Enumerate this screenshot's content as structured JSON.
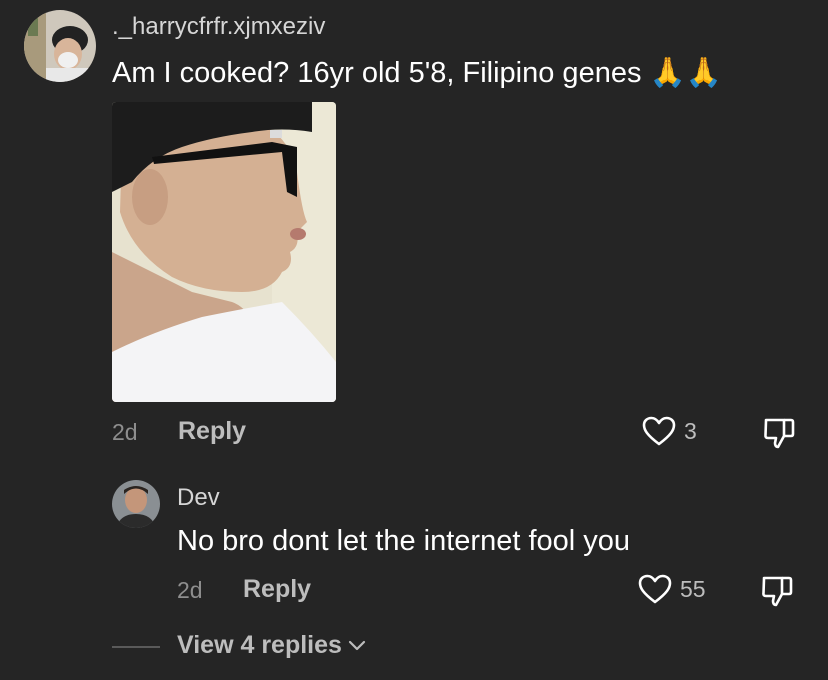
{
  "comment": {
    "username": "._harrycfrfr.xjmxeziv",
    "text": "Am I cooked? 16yr old 5'8, Filipino genes",
    "emoji": "🙏🙏",
    "time": "2d",
    "reply_label": "Reply",
    "like_count": "3",
    "liked": false
  },
  "reply": {
    "username": "Dev",
    "text": "No bro dont let the internet fool you",
    "time": "2d",
    "reply_label": "Reply",
    "like_count": "55",
    "liked": false
  },
  "view_replies": {
    "label": "View 4 replies"
  },
  "icons": {
    "like": "heart-outline-icon",
    "dislike": "thumbs-down-outline-icon",
    "expand": "chevron-down-icon"
  },
  "colors": {
    "background": "#252525",
    "primary_text": "#ffffff",
    "secondary_text": "#8e8e8e",
    "action_text": "#bdbdbd"
  }
}
